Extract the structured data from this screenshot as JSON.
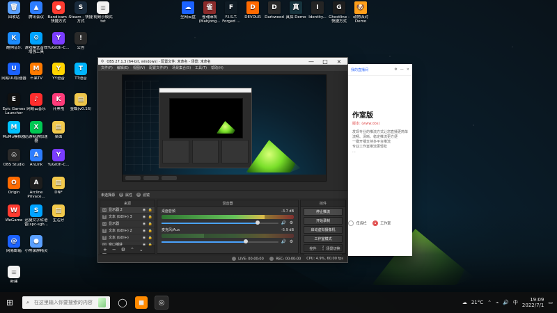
{
  "desktop": {
    "left_icons": [
      {
        "label": "回收站",
        "icon": "recycle-bin-icon",
        "color": "#5aa0ff",
        "glyph": "🗑"
      },
      {
        "label": "腾讯会议",
        "icon": "tencent-meeting-icon",
        "color": "#2d7dff",
        "glyph": "▲"
      },
      {
        "label": "Bandicam - 快捷方式",
        "icon": "bandicam-icon",
        "color": "#ff3b30",
        "glyph": "●"
      },
      {
        "label": "Steam - 快捷方式",
        "icon": "steam-icon",
        "color": "#1a2b3c",
        "glyph": "S"
      },
      {
        "label": "视频小模式 txt",
        "icon": "text-file-icon",
        "color": "#f2f2f2",
        "glyph": "≡"
      },
      {
        "label": "酷狗音乐",
        "icon": "kugou-icon",
        "color": "#1b8cff",
        "glyph": "K"
      },
      {
        "label": "游戏模式音效增强工具",
        "icon": "tool-icon",
        "color": "#00a3ff",
        "glyph": "⚙"
      },
      {
        "label": "YuGiOh-C...",
        "icon": "yugioh-icon",
        "color": "#7a3cff",
        "glyph": "Y"
      },
      {
        "label": "公告",
        "icon": "notice-icon",
        "color": "#2a2a2a",
        "glyph": "!"
      },
      {
        "label": "网易UU加速器",
        "icon": "uu-accelerator-icon",
        "color": "#1b62ff",
        "glyph": "U"
      },
      {
        "label": "芒果TV",
        "icon": "mango-tv-icon",
        "color": "#ff7a00",
        "glyph": "M"
      },
      {
        "label": "YY语音",
        "icon": "yy-voice-icon",
        "color": "#ffd400",
        "glyph": "Y"
      },
      {
        "label": "TT语音",
        "icon": "tt-voice-icon",
        "color": "#00b7ff",
        "glyph": "T"
      },
      {
        "label": "Epic Games Launcher",
        "icon": "epic-games-icon",
        "color": "#111111",
        "glyph": "E"
      },
      {
        "label": "网易云音乐",
        "icon": "netease-music-icon",
        "color": "#ff2d2d",
        "glyph": "♪"
      },
      {
        "label": "开黑啦",
        "icon": "kaiheila-icon",
        "color": "#ff3b7a",
        "glyph": "K"
      },
      {
        "label": "金蝶(v0.16)",
        "icon": "folder-icon",
        "color": "#f2c94c",
        "glyph": "▤"
      },
      {
        "label": "MuMu模拟器",
        "icon": "mumu-icon",
        "color": "#00c2ff",
        "glyph": "M"
      },
      {
        "label": "迅游网游加速器",
        "icon": "xunyou-icon",
        "color": "#00c853",
        "glyph": "X"
      },
      {
        "label": "桌面",
        "icon": "folder-icon",
        "color": "#f2c94c",
        "glyph": "▤"
      },
      {
        "label": "OBS Studio",
        "icon": "obs-icon",
        "color": "#2a2a2a",
        "glyph": "◎"
      },
      {
        "label": "AnLink",
        "icon": "anlink-icon",
        "color": "#2d7dff",
        "glyph": "A"
      },
      {
        "label": "YuGiOh-C...",
        "icon": "yugioh-icon",
        "color": "#7a3cff",
        "glyph": "Y"
      },
      {
        "label": "Origin",
        "icon": "origin-icon",
        "color": "#ff6a00",
        "glyph": "O"
      },
      {
        "label": "Arcline Privace...",
        "icon": "arcline-icon",
        "color": "#1d1d1d",
        "glyph": "A"
      },
      {
        "label": "DNF",
        "icon": "folder-icon",
        "color": "#f2c94c",
        "glyph": "▤"
      },
      {
        "label": "WeGame",
        "icon": "wegame-icon",
        "color": "#ff3b30",
        "glyph": "W"
      },
      {
        "label": "迅捷文字转语音(spc-sgh...",
        "icon": "speech-tool-icon",
        "color": "#00a3ff",
        "glyph": "S"
      },
      {
        "label": "生活分",
        "icon": "folder-icon",
        "color": "#f2c94c",
        "glyph": "▤"
      },
      {
        "label": "网易邮箱",
        "icon": "netease-mail-icon",
        "color": "#1b62ff",
        "glyph": "@"
      },
      {
        "label": "小熊录屏精灵",
        "icon": "screen-recorder-icon",
        "color": "#5aa0ff",
        "glyph": "●"
      },
      {
        "label": "新建",
        "icon": "text-file-icon",
        "color": "#f2f2f2",
        "glyph": "≡"
      }
    ],
    "top_icons": [
      {
        "label": "全网云盘",
        "icon": "cloud-drive-icon",
        "color": "#1b62ff",
        "glyph": "☁"
      },
      {
        "label": "雀魂麻将(Mahjong...",
        "icon": "mahjong-icon",
        "color": "#8b2b2b",
        "glyph": "雀"
      },
      {
        "label": "F.I.S.T. Forged ...",
        "icon": "game-icon",
        "color": "#0f1b24",
        "glyph": "F"
      },
      {
        "label": "DEVOUR",
        "icon": "devour-icon",
        "color": "#ff6a00",
        "glyph": "D"
      },
      {
        "label": "Darkwood",
        "icon": "darkwood-icon",
        "color": "#2a2a2a",
        "glyph": "D"
      },
      {
        "label": "真探 Demo",
        "icon": "game-icon",
        "color": "#16333d",
        "glyph": "真"
      },
      {
        "label": "Identity...",
        "icon": "game-icon",
        "color": "#242424",
        "glyph": "I"
      },
      {
        "label": "Ghostline - 快捷方式",
        "icon": "game-icon",
        "color": "#1e1e1e",
        "glyph": "G"
      },
      {
        "label": "动物派对 Demo",
        "icon": "game-icon",
        "color": "#ff9f1a",
        "glyph": "🐶"
      }
    ]
  },
  "obs": {
    "title": "OBS 27.1.3 (64-bit, windows) - 配置文件: 未命名 - 场景: 未命名",
    "menu": [
      "文件(F)",
      "编辑(E)",
      "视图(V)",
      "配置文件(P)",
      "场景集合(S)",
      "工具(T)",
      "帮助(H)"
    ],
    "scenes_label": "未选择源",
    "properties_label": "属性",
    "filters_label": "滤镜",
    "docks": {
      "sources_header": "来源",
      "mixer_header": "混音器",
      "controls_header": "控件"
    },
    "sources": [
      {
        "name": "显示器 2",
        "icon": "monitor-icon",
        "active": true
      },
      {
        "name": "文本 (GDI+) 3",
        "icon": "text-icon",
        "active": false
      },
      {
        "name": "显示器",
        "icon": "monitor-icon",
        "active": false
      },
      {
        "name": "文本 (GDI+) 2",
        "icon": "text-icon",
        "active": false
      },
      {
        "name": "文本 (GDI+)",
        "icon": "text-icon",
        "active": false
      },
      {
        "name": "窗口捕获",
        "icon": "window-icon",
        "active": false
      },
      {
        "name": "图像幻灯片",
        "icon": "image-icon",
        "active": false
      }
    ],
    "mixer": [
      {
        "name": "桌面音频",
        "db": "-3.7 dB",
        "level": 0.78,
        "volume": 0.82
      },
      {
        "name": "麦克风/Aux",
        "db": "-5.9 dB",
        "level": 0.32,
        "volume": 0.72
      }
    ],
    "controls": [
      {
        "label": "停止推流",
        "primary": true
      },
      {
        "label": "开始录制",
        "primary": false
      },
      {
        "label": "启动虚拟摄像机",
        "primary": false
      },
      {
        "label": "工作室模式",
        "primary": false
      },
      {
        "label": "设置",
        "primary": false
      },
      {
        "label": "退出",
        "primary": false
      }
    ],
    "bottom_tabs": [
      "控件",
      "场景切换"
    ],
    "status": {
      "live_label": "LIVE:",
      "live_time": "00:00:00",
      "rec_label": "REC:",
      "rec_time": "00:00:00",
      "cpu": "CPU: 4.9%, 60.00 fps"
    }
  },
  "side_window": {
    "link": "我的直播间",
    "big_title": "作室版",
    "red_line": "版本: (www.obs)",
    "desc_lines": [
      "发现专业的推流方式让您直播更简单",
      "流畅、清晰、稳定推流更方便",
      "一键开播支持多平台推流",
      "专业工作室推流更轻松",
      "..."
    ],
    "options": [
      {
        "label": "任务栏",
        "selected": false
      },
      {
        "label": "工作室",
        "selected": true
      }
    ]
  },
  "taskbar": {
    "search_placeholder": "在这里输入你要搜索的内容",
    "temperature": "21°C",
    "time": "19:09",
    "date": "2022/7/1",
    "lang": "中"
  }
}
